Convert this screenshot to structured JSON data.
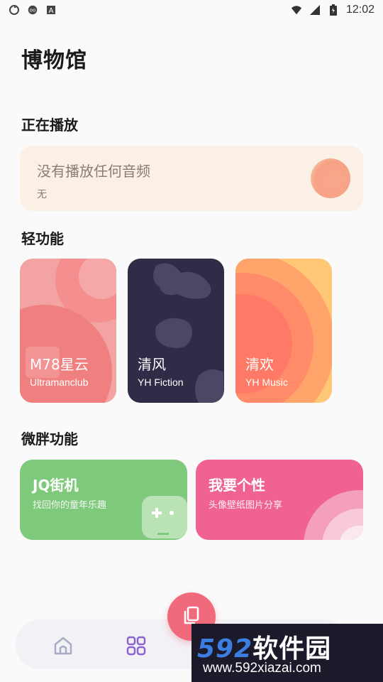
{
  "status_bar": {
    "time": "12:02",
    "icons_left": [
      "sync-icon",
      "cast-icon",
      "a-icon"
    ],
    "icons_right": [
      "wifi-icon",
      "signal-icon",
      "battery-icon"
    ]
  },
  "header": {
    "title": "博物馆"
  },
  "now_playing": {
    "section_title": "正在播放",
    "title": "没有播放任何音频",
    "subtitle": "无"
  },
  "light_features": {
    "section_title": "轻功能",
    "items": [
      {
        "title": "M78星云",
        "subtitle": "Ultramanclub",
        "color": "#f4a3a3"
      },
      {
        "title": "清风",
        "subtitle": "YH Fiction",
        "color": "#2e2c46"
      },
      {
        "title": "清欢",
        "subtitle": "YH Music",
        "color": "#ffc876"
      }
    ]
  },
  "micro_features": {
    "section_title": "微胖功能",
    "items": [
      {
        "title": "JQ街机",
        "subtitle": "找回你的童年乐趣",
        "color": "#7fc97d"
      },
      {
        "title": "我要个性",
        "subtitle": "头像壁纸图片分享",
        "color": "#f06390"
      }
    ]
  },
  "bottom_nav": {
    "items": [
      {
        "icon": "home-icon"
      },
      {
        "icon": "grid-icon",
        "active_color": "#8a63d2"
      }
    ],
    "fab_icon": "library-icon",
    "fab_color": "#f16a7c"
  },
  "watermark": {
    "logo_num": "592",
    "logo_text": "软件园",
    "url": "www.592xiazai.com"
  }
}
